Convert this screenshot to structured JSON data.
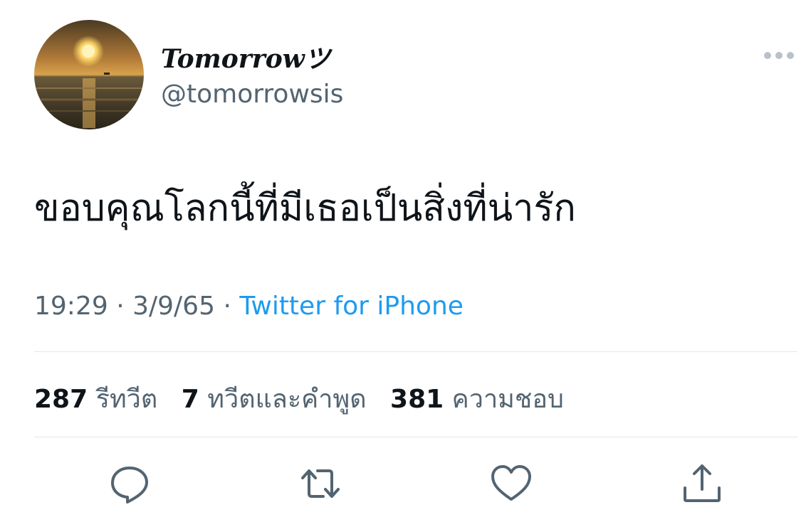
{
  "tweet": {
    "display_name": "Tomorrowツ",
    "handle": "@tomorrowsis",
    "text": "ขอบคุณโลกนี้ที่มีเธอเป็นสิ่งที่น่ารัก",
    "time": "19:29",
    "date": "3/9/65",
    "separator": "·",
    "source": "Twitter for iPhone"
  },
  "stats": {
    "retweets": {
      "count": "287",
      "label": "รีทวีต"
    },
    "quotes": {
      "count": "7",
      "label": "ทวีตและคำพูด"
    },
    "likes": {
      "count": "381",
      "label": "ความชอบ"
    }
  },
  "icons": {
    "more": "more-horizontal-icon",
    "reply": "reply-bubble-icon",
    "retweet": "retweet-icon",
    "like": "heart-icon",
    "share": "share-upload-icon"
  },
  "colors": {
    "text": "#0f1419",
    "secondary": "#536471",
    "link": "#1d9bf0",
    "divider": "#e3e6e9"
  }
}
